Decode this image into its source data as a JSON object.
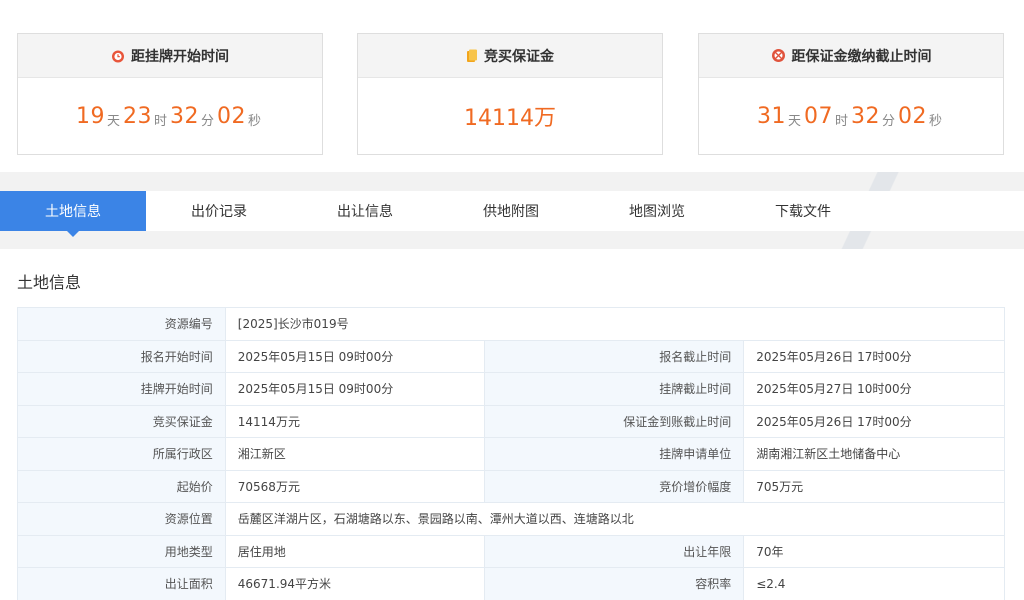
{
  "cards": [
    {
      "title": "距挂牌开始时间",
      "icon": "alarm-clock-icon",
      "parts": [
        {
          "num": "19",
          "unit": "天"
        },
        {
          "num": "23",
          "unit": "时"
        },
        {
          "num": "32",
          "unit": "分"
        },
        {
          "num": "02",
          "unit": "秒"
        }
      ]
    },
    {
      "title": "竞买保证金",
      "icon": "coins-icon",
      "value": "14114万"
    },
    {
      "title": "距保证金缴纳截止时间",
      "icon": "timer-icon",
      "parts": [
        {
          "num": "31",
          "unit": "天"
        },
        {
          "num": "07",
          "unit": "时"
        },
        {
          "num": "32",
          "unit": "分"
        },
        {
          "num": "02",
          "unit": "秒"
        }
      ]
    }
  ],
  "tabs": [
    {
      "label": "土地信息",
      "active": true
    },
    {
      "label": "出价记录"
    },
    {
      "label": "出让信息"
    },
    {
      "label": "供地附图"
    },
    {
      "label": "地图浏览"
    },
    {
      "label": "下载文件"
    }
  ],
  "section_title": "土地信息",
  "table": {
    "resource_no": {
      "k": "资源编号",
      "v": "[2025]长沙市019号"
    },
    "rows": [
      [
        {
          "k": "报名开始时间",
          "v": "2025年05月15日 09时00分"
        },
        {
          "k": "报名截止时间",
          "v": "2025年05月26日 17时00分"
        }
      ],
      [
        {
          "k": "挂牌开始时间",
          "v": "2025年05月15日 09时00分"
        },
        {
          "k": "挂牌截止时间",
          "v": "2025年05月27日 10时00分"
        }
      ],
      [
        {
          "k": "竞买保证金",
          "v": "14114万元"
        },
        {
          "k": "保证金到账截止时间",
          "v": "2025年05月26日 17时00分"
        }
      ],
      [
        {
          "k": "所属行政区",
          "v": "湘江新区"
        },
        {
          "k": "挂牌申请单位",
          "v": "湖南湘江新区土地储备中心"
        }
      ],
      [
        {
          "k": "起始价",
          "v": "70568万元"
        },
        {
          "k": "竞价增价幅度",
          "v": "705万元"
        }
      ]
    ],
    "location": {
      "k": "资源位置",
      "v": "岳麓区洋湖片区，石湖塘路以东、景园路以南、潭州大道以西、连塘路以北"
    },
    "rows2": [
      [
        {
          "k": "用地类型",
          "v": "居住用地"
        },
        {
          "k": "出让年限",
          "v": "70年"
        }
      ],
      [
        {
          "k": "出让面积",
          "v": "46671.94平方米"
        },
        {
          "k": "容积率",
          "v": "≤2.4"
        }
      ]
    ]
  },
  "colors": {
    "accent": "#3b84e6",
    "countdown": "#f06a22"
  }
}
